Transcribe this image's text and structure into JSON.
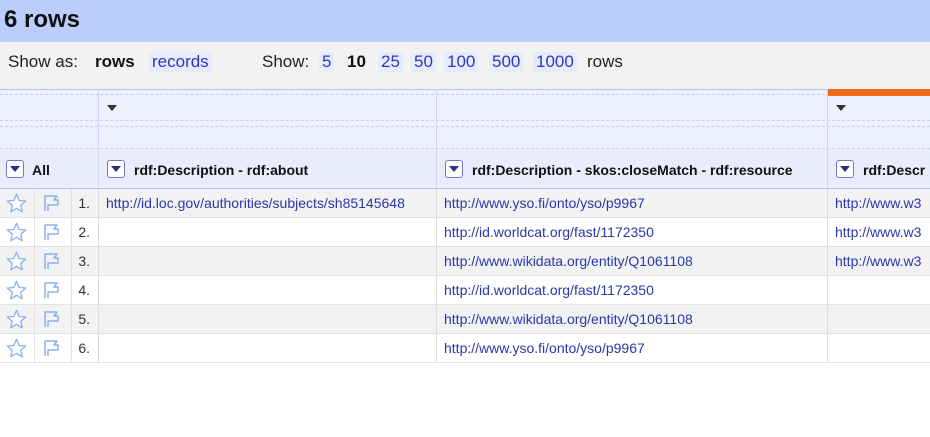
{
  "header": {
    "title": "6 rows"
  },
  "viewbar": {
    "show_as_label": "Show as:",
    "rows_option": "rows",
    "records_option": "records",
    "show_label": "Show:",
    "page_sizes": [
      "5",
      "10",
      "25",
      "50",
      "100",
      "500",
      "1000"
    ],
    "selected_page_size": "10",
    "rows_suffix": "rows"
  },
  "columns": {
    "all_label": "All",
    "col1": "rdf:Description - rdf:about",
    "col2": "rdf:Description - skos:closeMatch - rdf:resource",
    "col3": "rdf:Descr"
  },
  "rows": [
    {
      "num": "1.",
      "c1": "http://id.loc.gov/authorities/subjects/sh85145648",
      "c2": "http://www.yso.fi/onto/yso/p9967",
      "c3": "http://www.w3"
    },
    {
      "num": "2.",
      "c1": "",
      "c2": "http://id.worldcat.org/fast/1172350",
      "c3": "http://www.w3"
    },
    {
      "num": "3.",
      "c1": "",
      "c2": "http://www.wikidata.org/entity/Q1061108",
      "c3": "http://www.w3"
    },
    {
      "num": "4.",
      "c1": "",
      "c2": "http://id.worldcat.org/fast/1172350",
      "c3": ""
    },
    {
      "num": "5.",
      "c1": "",
      "c2": "http://www.wikidata.org/entity/Q1061108",
      "c3": ""
    },
    {
      "num": "6.",
      "c1": "",
      "c2": "http://www.yso.fi/onto/yso/p9967",
      "c3": ""
    }
  ],
  "colors": {
    "title_bar": "#bacdfd",
    "link": "#2b37a8",
    "active_column": "#f26b1d"
  }
}
